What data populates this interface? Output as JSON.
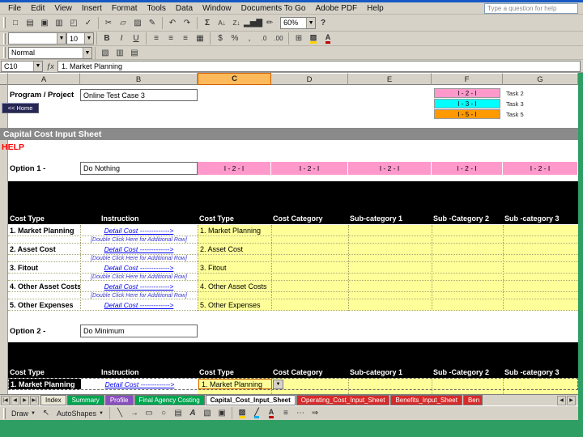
{
  "colors": {
    "band_pink": "#ff99cc",
    "band_cyan": "#00ffff",
    "band_orange": "#ff9900",
    "input_yellow": "#ffff99",
    "desktop_green": "#2f9e63",
    "section_gray": "#8a8a8a",
    "header_black": "#000000",
    "link_blue": "#0000ee",
    "help_red": "#ff0000"
  },
  "menu_items": [
    "File",
    "Edit",
    "View",
    "Insert",
    "Format",
    "Tools",
    "Data",
    "Window",
    "Documents To Go",
    "Adobe PDF",
    "Help"
  ],
  "help_prompt": "Type a question for help",
  "standard_toolbar": {
    "zoom_value": "60%"
  },
  "formatting_toolbar": {
    "font_size": "10",
    "style_name": "Normal"
  },
  "formula_bar": {
    "cell_ref": "C10",
    "value": "1. Market Planning"
  },
  "column_headers": [
    "A",
    "B",
    "C",
    "D",
    "E",
    "F",
    "G"
  ],
  "legend": {
    "items": [
      {
        "code": "I - 2 - I",
        "label": "Task 2",
        "color": "#ff99cc"
      },
      {
        "code": "I - 3 - I",
        "label": "Task 3",
        "color": "#00ffff"
      },
      {
        "code": "I - 5 - I",
        "label": "Task 5",
        "color": "#ff9900"
      }
    ]
  },
  "sheet": {
    "program_label": "Program / Project",
    "program_value": "Online Test Case 3",
    "home_button": "<< Home",
    "section_title": "Capital Cost Input Sheet",
    "help_link": "HELP",
    "option1_label": "Option 1 -",
    "option1_value": "Do Nothing",
    "option1_band_code": "I - 2 - I",
    "option1_band_color": "#ff99cc",
    "option2_label": "Option 2 -",
    "option2_value": "Do Minimum",
    "table_headers": [
      "Cost Type",
      "Instruction",
      "Cost Type",
      "Cost Category",
      "Sub-category 1",
      "Sub -Category 2",
      "Sub -category 3"
    ],
    "instruction_link": "Detail Cost ------------->",
    "row_hint": "[Double Click Here for Additional Row]",
    "cost_rows": [
      "1. Market Planning",
      "2. Asset Cost",
      "3. Fitout",
      "4. Other Asset Costs",
      "5. Other Expenses"
    ],
    "option2_first_row": "1. Market Planning"
  },
  "tabs": [
    {
      "label": "Index",
      "color": "#ece9d8",
      "text": "#000000"
    },
    {
      "label": "Summary",
      "color": "#00a550",
      "text": "#ffffff"
    },
    {
      "label": "Profile",
      "color": "#8a4fbf",
      "text": "#ffffff"
    },
    {
      "label": "Final Agency Costing",
      "color": "#00a550",
      "text": "#ffffff"
    },
    {
      "label": "Capital_Cost_Input_Sheet",
      "color": "#ffffff",
      "text": "#000000"
    },
    {
      "label": "Operating_Cost_Input_Sheet",
      "color": "#d62b2b",
      "text": "#ffffff"
    },
    {
      "label": "Benefits_Input_Sheet",
      "color": "#d62b2b",
      "text": "#ffffff"
    },
    {
      "label": "Ben",
      "color": "#d62b2b",
      "text": "#ffffff"
    }
  ],
  "drawing_toolbar": {
    "draw_label": "Draw",
    "autoshapes_label": "AutoShapes"
  }
}
